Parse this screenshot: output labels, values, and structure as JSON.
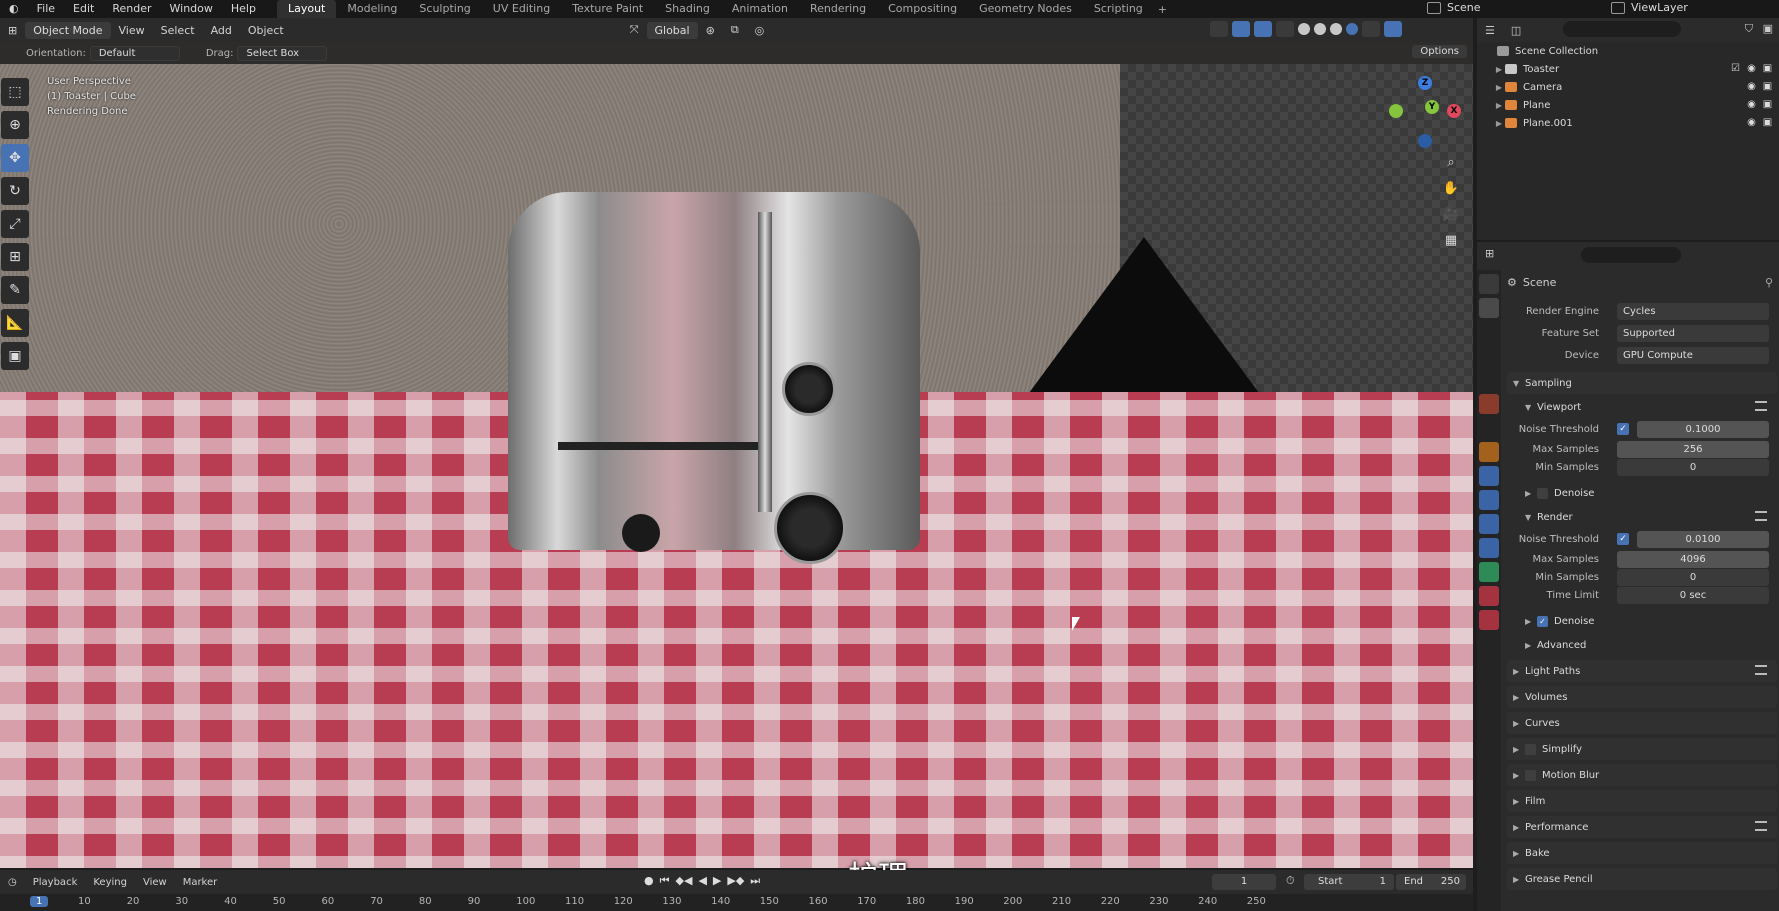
{
  "menu": [
    "File",
    "Edit",
    "Render",
    "Window",
    "Help"
  ],
  "workspaces": [
    {
      "label": "Layout",
      "active": true
    },
    {
      "label": "Modeling"
    },
    {
      "label": "Sculpting"
    },
    {
      "label": "UV Editing"
    },
    {
      "label": "Texture Paint"
    },
    {
      "label": "Shading"
    },
    {
      "label": "Animation"
    },
    {
      "label": "Rendering"
    },
    {
      "label": "Compositing"
    },
    {
      "label": "Geometry Nodes"
    },
    {
      "label": "Scripting"
    }
  ],
  "scene_name": "Scene",
  "view_layer": "ViewLayer",
  "viewport": {
    "mode": "Object Mode",
    "menus": [
      "View",
      "Select",
      "Add",
      "Object"
    ],
    "transform_orientation": "Global",
    "orientation_label": "Orientation:",
    "orientation_value": "Default",
    "drag_label": "Drag:",
    "drag_value": "Select Box",
    "options_label": "Options",
    "info_line1": "User Perspective",
    "info_line2": "(1) Toaster | Cube",
    "info_line3": "Rendering Done",
    "gizmo_axes": {
      "z": "Z",
      "y": "Y",
      "x": "X"
    }
  },
  "subtitle": "护理",
  "timeline": {
    "menus": [
      "Playback",
      "Keying",
      "View",
      "Marker"
    ],
    "current_frame": "1",
    "start_label": "Start",
    "start_value": "1",
    "end_label": "End",
    "end_value": "250",
    "ruler": [
      "1",
      "10",
      "20",
      "30",
      "40",
      "50",
      "60",
      "70",
      "80",
      "90",
      "100",
      "110",
      "120",
      "130",
      "140",
      "150",
      "160",
      "170",
      "180",
      "190",
      "200",
      "210",
      "220",
      "230",
      "240",
      "250"
    ]
  },
  "outliner": {
    "root": "Scene Collection",
    "items": [
      {
        "name": "Toaster",
        "color": "#c8c8c8"
      },
      {
        "name": "Camera",
        "color": "#e0863c"
      },
      {
        "name": "Plane",
        "color": "#e0863c"
      },
      {
        "name": "Plane.001",
        "color": "#e0863c"
      }
    ]
  },
  "properties": {
    "context": "Scene",
    "render_engine_label": "Render Engine",
    "render_engine": "Cycles",
    "feature_set_label": "Feature Set",
    "feature_set": "Supported",
    "device_label": "Device",
    "device": "GPU Compute",
    "sampling": "Sampling",
    "viewport_panel": "Viewport",
    "viewport_noise_threshold_label": "Noise Threshold",
    "viewport_noise_threshold": "0.1000",
    "viewport_max_samples_label": "Max Samples",
    "viewport_max_samples": "256",
    "viewport_min_samples_label": "Min Samples",
    "viewport_min_samples": "0",
    "denoise_panel": "Denoise",
    "render_panel": "Render",
    "render_noise_threshold_label": "Noise Threshold",
    "render_noise_threshold": "0.0100",
    "render_max_samples_label": "Max Samples",
    "render_max_samples": "4096",
    "render_min_samples_label": "Min Samples",
    "render_min_samples": "0",
    "time_limit_label": "Time Limit",
    "time_limit": "0 sec",
    "render_denoise": "Denoise",
    "advanced": "Advanced",
    "panels": [
      "Light Paths",
      "Volumes",
      "Curves",
      "Simplify",
      "Motion Blur",
      "Film",
      "Performance",
      "Bake",
      "Grease Pencil"
    ]
  },
  "colors": {
    "accent": "#4772b3",
    "cloth_red": "#b83c52"
  }
}
